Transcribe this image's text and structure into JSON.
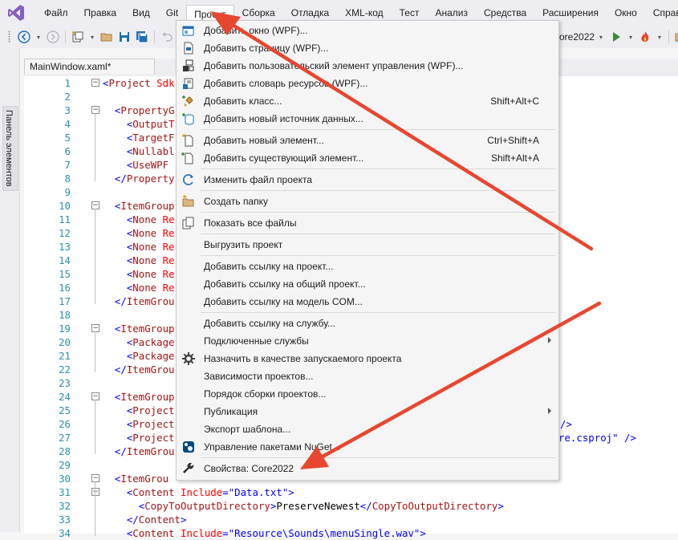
{
  "menubar": {
    "items": [
      "Файл",
      "Правка",
      "Вид",
      "Git",
      "Проект",
      "Сборка",
      "Отладка",
      "XML-код",
      "Тест",
      "Анализ",
      "Средства",
      "Расширения",
      "Окно",
      "Справка"
    ],
    "active": "Проект"
  },
  "toolbar": {
    "target_fragment": "ore2022",
    "icons": [
      "back-icon",
      "forward-icon",
      "new-project-icon",
      "open-folder-icon",
      "save-icon",
      "save-all-icon",
      "undo-icon",
      "start-icon",
      "hot-reload-icon",
      "solution-explorer-icon"
    ]
  },
  "side_panel": {
    "tab_label": "Панель элементов"
  },
  "editor": {
    "tab_label": "MainWindow.xaml*",
    "lines": [
      {
        "n": "1",
        "seg": [
          [
            "t-blue",
            "<"
          ],
          [
            "t-brown",
            "Project "
          ],
          [
            "t-red",
            "Sdk"
          ]
        ],
        "fold": "-",
        "indent": 0
      },
      {
        "n": "2",
        "seg": [],
        "indent": 0
      },
      {
        "n": "3",
        "seg": [
          [
            "t-blue",
            "<"
          ],
          [
            "t-brown",
            "PropertyG"
          ]
        ],
        "fold": "-",
        "indent": 1
      },
      {
        "n": "4",
        "seg": [
          [
            "t-blue",
            "<"
          ],
          [
            "t-brown",
            "OutputT"
          ]
        ],
        "indent": 2
      },
      {
        "n": "5",
        "seg": [
          [
            "t-blue",
            "<"
          ],
          [
            "t-brown",
            "TargetF"
          ]
        ],
        "indent": 2
      },
      {
        "n": "6",
        "seg": [
          [
            "t-blue",
            "<"
          ],
          [
            "t-brown",
            "Nullabl"
          ]
        ],
        "indent": 2
      },
      {
        "n": "7",
        "seg": [
          [
            "t-blue",
            "<"
          ],
          [
            "t-brown",
            "UseWPF"
          ]
        ],
        "indent": 2
      },
      {
        "n": "8",
        "seg": [
          [
            "t-blue",
            "</"
          ],
          [
            "t-brown",
            "Property"
          ]
        ],
        "indent": 1
      },
      {
        "n": "9",
        "seg": [],
        "indent": 0
      },
      {
        "n": "10",
        "seg": [
          [
            "t-blue",
            "<"
          ],
          [
            "t-brown",
            "ItemGroup"
          ]
        ],
        "fold": "-",
        "indent": 1
      },
      {
        "n": "11",
        "seg": [
          [
            "t-blue",
            "<"
          ],
          [
            "t-brown",
            "None "
          ],
          [
            "t-red",
            "Re"
          ]
        ],
        "indent": 2
      },
      {
        "n": "12",
        "seg": [
          [
            "t-blue",
            "<"
          ],
          [
            "t-brown",
            "None "
          ],
          [
            "t-red",
            "Re"
          ]
        ],
        "indent": 2
      },
      {
        "n": "13",
        "seg": [
          [
            "t-blue",
            "<"
          ],
          [
            "t-brown",
            "None "
          ],
          [
            "t-red",
            "Re"
          ]
        ],
        "indent": 2
      },
      {
        "n": "14",
        "seg": [
          [
            "t-blue",
            "<"
          ],
          [
            "t-brown",
            "None "
          ],
          [
            "t-red",
            "Re"
          ]
        ],
        "indent": 2
      },
      {
        "n": "15",
        "seg": [
          [
            "t-blue",
            "<"
          ],
          [
            "t-brown",
            "None "
          ],
          [
            "t-red",
            "Re"
          ]
        ],
        "indent": 2
      },
      {
        "n": "16",
        "seg": [
          [
            "t-blue",
            "<"
          ],
          [
            "t-brown",
            "None "
          ],
          [
            "t-red",
            "Re"
          ]
        ],
        "indent": 2
      },
      {
        "n": "17",
        "seg": [
          [
            "t-blue",
            "</"
          ],
          [
            "t-brown",
            "ItemGrou"
          ]
        ],
        "indent": 1
      },
      {
        "n": "18",
        "seg": [],
        "indent": 0
      },
      {
        "n": "19",
        "seg": [
          [
            "t-blue",
            "<"
          ],
          [
            "t-brown",
            "ItemGroup"
          ]
        ],
        "fold": "-",
        "indent": 1
      },
      {
        "n": "20",
        "seg": [
          [
            "t-blue",
            "<"
          ],
          [
            "t-brown",
            "Package"
          ]
        ],
        "indent": 2
      },
      {
        "n": "21",
        "seg": [
          [
            "t-blue",
            "<"
          ],
          [
            "t-brown",
            "Package"
          ]
        ],
        "indent": 2
      },
      {
        "n": "22",
        "seg": [
          [
            "t-blue",
            "</"
          ],
          [
            "t-brown",
            "ItemGrou"
          ]
        ],
        "indent": 1
      },
      {
        "n": "23",
        "seg": [],
        "indent": 0
      },
      {
        "n": "24",
        "seg": [
          [
            "t-blue",
            "<"
          ],
          [
            "t-brown",
            "ItemGroup"
          ]
        ],
        "fold": "-",
        "indent": 1
      },
      {
        "n": "25",
        "seg": [
          [
            "t-blue",
            "<"
          ],
          [
            "t-brown",
            "Project"
          ]
        ],
        "indent": 2
      },
      {
        "n": "26",
        "seg": [
          [
            "t-blue",
            "<"
          ],
          [
            "t-brown",
            "Project"
          ]
        ],
        "indent": 2
      },
      {
        "n": "27",
        "seg": [
          [
            "t-blue",
            "<"
          ],
          [
            "t-brown",
            "Project"
          ]
        ],
        "indent": 2
      },
      {
        "n": "28",
        "seg": [
          [
            "t-blue",
            "</"
          ],
          [
            "t-brown",
            "ItemGrou"
          ]
        ],
        "indent": 1
      },
      {
        "n": "29",
        "seg": [],
        "indent": 0
      },
      {
        "n": "30",
        "seg": [
          [
            "t-blue",
            "<"
          ],
          [
            "t-brown",
            "ItemGrou"
          ]
        ],
        "fold": "-",
        "indent": 1
      },
      {
        "n": "31",
        "seg": [
          [
            "t-blue",
            "<"
          ],
          [
            "t-brown",
            "Content "
          ],
          [
            "t-red",
            "Include"
          ],
          [
            "t-blue",
            "=\""
          ],
          [
            "t-blue",
            "Data.txt"
          ],
          [
            "t-blue",
            "\">"
          ]
        ],
        "fold": "-",
        "indent": 2
      },
      {
        "n": "32",
        "seg": [
          [
            "t-blue",
            "<"
          ],
          [
            "t-brown",
            "CopyToOutputDirectory"
          ],
          [
            "t-blue",
            ">"
          ],
          [
            "t-black",
            "PreserveNewest"
          ],
          [
            "t-blue",
            "</"
          ],
          [
            "t-brown",
            "CopyToOutputDirectory"
          ],
          [
            "t-blue",
            ">"
          ]
        ],
        "indent": 3
      },
      {
        "n": "33",
        "seg": [
          [
            "t-blue",
            "</"
          ],
          [
            "t-brown",
            "Content"
          ],
          [
            "t-blue",
            ">"
          ]
        ],
        "indent": 2
      },
      {
        "n": "34",
        "seg": [
          [
            "t-blue",
            "<"
          ],
          [
            "t-brown",
            "Content "
          ],
          [
            "t-red",
            "Include"
          ],
          [
            "t-blue",
            "=\""
          ],
          [
            "t-blue",
            "Resource\\Sounds\\menuSingle.wav"
          ],
          [
            "t-blue",
            "\">"
          ]
        ],
        "indent": 2
      }
    ],
    "right_fragments": [
      {
        "line": "26",
        "text": "/>"
      },
      {
        "line": "27",
        "text": "re.csproj\" />"
      }
    ]
  },
  "dropdown": {
    "items": [
      {
        "label": "Добавить окно (WPF)...",
        "icon": "add-window-icon"
      },
      {
        "label": "Добавить страницу (WPF)...",
        "icon": "add-page-icon"
      },
      {
        "label": "Добавить пользовательский элемент управления (WPF)...",
        "icon": "add-user-control-icon"
      },
      {
        "label": "Добавить словарь ресурсов (WPF)...",
        "icon": "add-resource-dictionary-icon"
      },
      {
        "label": "Добавить класс...",
        "icon": "add-class-icon",
        "shortcut": "Shift+Alt+C"
      },
      {
        "label": "Добавить новый источник данных...",
        "icon": "add-data-source-icon"
      },
      {
        "sep": true
      },
      {
        "label": "Добавить новый элемент...",
        "icon": "add-new-item-icon",
        "shortcut": "Ctrl+Shift+A"
      },
      {
        "label": "Добавить существующий элемент...",
        "icon": "add-existing-item-icon",
        "shortcut": "Shift+Alt+A"
      },
      {
        "sep": true
      },
      {
        "label": "Изменить файл проекта",
        "icon": "edit-project-file-icon"
      },
      {
        "sep": true
      },
      {
        "label": "Создать папку",
        "icon": "new-folder-icon"
      },
      {
        "sep": true
      },
      {
        "label": "Показать все файлы",
        "icon": "show-all-files-icon"
      },
      {
        "sep": true
      },
      {
        "label": "Выгрузить проект"
      },
      {
        "sep": true
      },
      {
        "label": "Добавить ссылку на проект..."
      },
      {
        "label": "Добавить ссылку на общий проект..."
      },
      {
        "label": "Добавить ссылку на модель COM..."
      },
      {
        "sep": true
      },
      {
        "label": "Добавить ссылку на службу..."
      },
      {
        "label": "Подключенные службы",
        "submenu": true
      },
      {
        "label": "Назначить в качестве запускаемого проекта",
        "icon": "gear-icon"
      },
      {
        "label": "Зависимости проектов..."
      },
      {
        "label": "Порядок сборки проектов..."
      },
      {
        "label": "Публикация",
        "submenu": true
      },
      {
        "label": "Экспорт шаблона..."
      },
      {
        "label": "Управление пакетами NuGet...",
        "icon": "nuget-icon"
      },
      {
        "sep": true
      },
      {
        "label": "Свойства: Core2022",
        "icon": "wrench-icon"
      }
    ]
  },
  "colors": {
    "annotation_arrow": "#e8472f",
    "xml_tag": "#a31515",
    "xml_bracket": "#0000ff",
    "xml_attr": "#ff0000",
    "line_number": "#2b91af"
  }
}
